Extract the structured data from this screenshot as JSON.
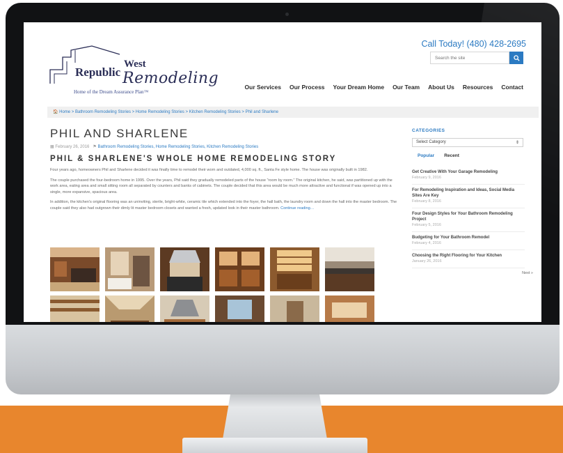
{
  "header": {
    "logo": {
      "name1": "Republic",
      "name2": "West",
      "name3": "Remodeling",
      "tagline": "Home of the Dream Assurance Plan™"
    },
    "call": "Call Today! (480) 428-2695",
    "search": {
      "placeholder": "Search the site"
    },
    "nav": [
      "Our Services",
      "Our Process",
      "Your Dream Home",
      "Our Team",
      "About Us",
      "Resources",
      "Contact"
    ]
  },
  "breadcrumb": "🏠 Home > Bathroom Remodeling Stories > Home Remodeling Stories > Kitchen Remodeling Stories > Phil and Sharlene",
  "article": {
    "title": "PHIL AND SHARLENE",
    "date": "February 26, 2016",
    "categories": "Bathroom Remodeling Stories, Home Remodeling Stories, Kitchen Remodeling Stories",
    "subtitle": "PHIL & SHARLENE'S WHOLE HOME REMODELING STORY",
    "paragraphs": [
      "Four years ago, homeowners Phil and Sharlene decided it was finally time to remodel their worn and outdated, 4,000 sq. ft., Santa Fe style home. The house was originally built in 1982.",
      "The couple purchased the four-bedroom home in 1995. Over the years, Phil said they gradually remodeled parts of the house “room by room.” The original kitchen, he said, was partitioned up with the work area, eating area and small sitting room all separated by counters and banks of cabinets. The couple decided that this area would be much more attractive and functional if was opened up into a single, more expansive, spacious area.",
      "In addition, the kitchen's original flooring was an uninviting, sterile, bright-white, ceramic tile which extended into the foyer, the hall bath, the laundry room and down the hall into the master bedroom. The couple said they also had outgrown their dimly lit master bedroom closets and wanted a fresh, updated look in their master bathroom."
    ],
    "continue": "Continue reading…"
  },
  "sidebar": {
    "heading": "CATEGORIES",
    "select": "Select Category",
    "tabs": [
      "Popular",
      "Recent"
    ],
    "posts": [
      {
        "title": "Get Creative With Your Garage Remodeling",
        "date": "February 9, 2016"
      },
      {
        "title": "For Remodeling Inspiration and Ideas, Social Media Sites Are Key",
        "date": "February 8, 2016"
      },
      {
        "title": "Four Design Styles for Your Bathroom Remodeling Project",
        "date": "February 5, 2016"
      },
      {
        "title": "Budgeting for Your Bathroom Remodel",
        "date": "February 4, 2016"
      },
      {
        "title": "Choosing the Right Flooring for Your Kitchen",
        "date": "January 26, 2016"
      }
    ],
    "next": "Next »"
  },
  "gallery": {
    "images": [
      "kitchen-photo",
      "bathroom-photo",
      "kitchen-range-photo",
      "cabinet-photo",
      "hutch-photo",
      "kitchen-counter-photo",
      "ceiling-beams-photo",
      "kitchen-island-photo",
      "kitchen-hood-photo",
      "kitchen-window-photo",
      "hallway-photo",
      "living-room-photo"
    ]
  },
  "colors": {
    "accent": "#2b7ac2",
    "floor": "#e8862d",
    "bezel": "#111214",
    "logo": "#2a2d56"
  }
}
